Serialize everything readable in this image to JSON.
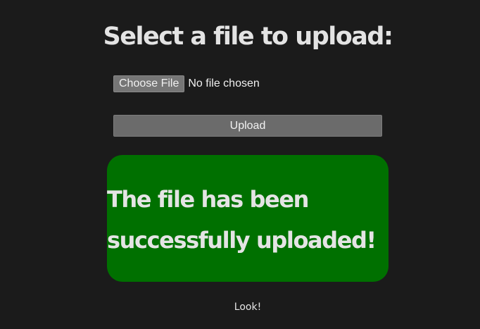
{
  "page": {
    "heading": "Select a file to upload:"
  },
  "file_input": {
    "choose_label": "Choose File",
    "status_text": "No file chosen"
  },
  "upload_button": {
    "label": "Upload"
  },
  "success_message": {
    "line1": "The file has been",
    "line2": "successfully uploaded!",
    "background_color": "#007000"
  },
  "footer_link": {
    "label": "Look!"
  },
  "theme": {
    "background": "#1b1b1b",
    "text": "#e6e6e6"
  }
}
